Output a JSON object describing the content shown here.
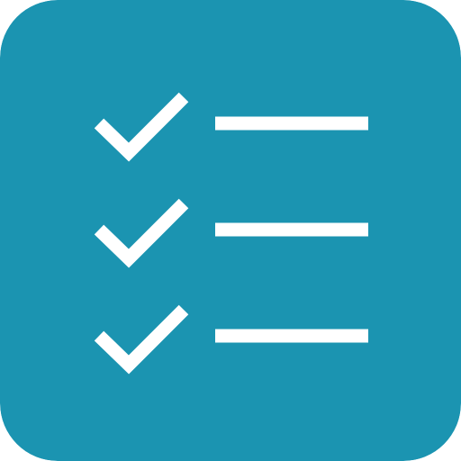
{
  "icon": {
    "semantic": "checklist-app-icon",
    "background_color": "#1b94b1",
    "foreground_color": "#ffffff",
    "items": [
      {
        "icon": "checkmark-icon",
        "checked": true,
        "line": "text-line"
      },
      {
        "icon": "checkmark-icon",
        "checked": true,
        "line": "text-line"
      },
      {
        "icon": "checkmark-icon",
        "checked": true,
        "line": "text-line"
      }
    ]
  }
}
